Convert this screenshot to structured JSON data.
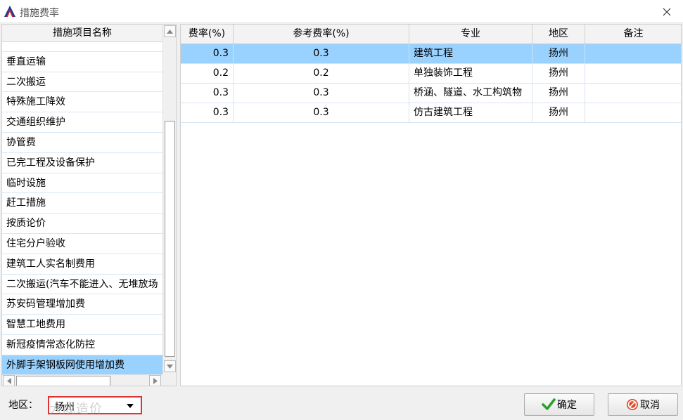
{
  "window": {
    "title": "措施费率"
  },
  "left_panel": {
    "header": "措施项目名称",
    "items": [
      "",
      "垂直运输",
      "二次搬运",
      "特殊施工降效",
      "交通组织维护",
      "协管费",
      "已完工程及设备保护",
      "临时设施",
      "赶工措施",
      "按质论价",
      "住宅分户验收",
      "建筑工人实名制费用",
      "二次搬运(汽车不能进入、无堆放场",
      "苏安码管理增加费",
      "智慧工地费用",
      "新冠疫情常态化防控",
      "外脚手架钢板网使用增加费"
    ],
    "selected_index": 16
  },
  "grid": {
    "columns": [
      "费率(%)",
      "参考费率(%)",
      "专业",
      "地区",
      "备注"
    ],
    "rows": [
      [
        "0.3",
        "0.3",
        "建筑工程",
        "扬州",
        ""
      ],
      [
        "0.2",
        "0.2",
        "单独装饰工程",
        "扬州",
        ""
      ],
      [
        "0.3",
        "0.3",
        "桥涵、隧道、水工构筑物",
        "扬州",
        ""
      ],
      [
        "0.3",
        "0.3",
        "仿古建筑工程",
        "扬州",
        ""
      ]
    ],
    "selected_row": 0
  },
  "footer": {
    "region_label": "地区：",
    "region_value": "扬州",
    "watermark": "大成造价",
    "ok_label": "确定",
    "cancel_label": "取消"
  },
  "colors": {
    "selection": "#99d1ff",
    "highlight_border": "#e03333",
    "ok_icon": "#2aa02a",
    "cancel_icon": "#e04a2a"
  }
}
